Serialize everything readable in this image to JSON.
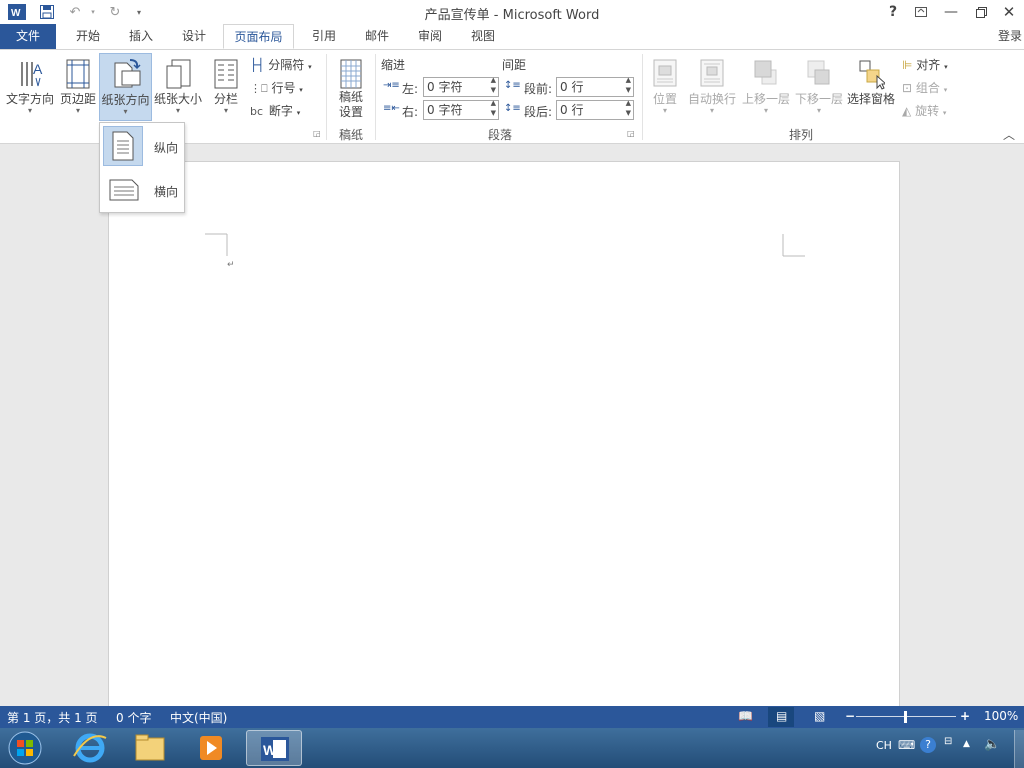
{
  "window": {
    "title": "产品宣传单 - Microsoft Word",
    "help": "?",
    "login": "登录"
  },
  "tabs": [
    {
      "label": "文件"
    },
    {
      "label": "开始"
    },
    {
      "label": "插入"
    },
    {
      "label": "设计"
    },
    {
      "label": "页面布局"
    },
    {
      "label": "引用"
    },
    {
      "label": "邮件"
    },
    {
      "label": "审阅"
    },
    {
      "label": "视图"
    }
  ],
  "ribbon": {
    "page_setup": {
      "text_direction": "文字方向",
      "margins": "页边距",
      "orientation": "纸张方向",
      "size": "纸张大小",
      "columns": "分栏",
      "breaks": "分隔符",
      "line_numbers": "行号",
      "hyphenation": "断字",
      "hyphen_icon": "bc"
    },
    "manuscript": {
      "button_line1": "稿纸",
      "button_line2": "设置",
      "group": "稿纸"
    },
    "paragraph": {
      "indent_label": "缩进",
      "spacing_label": "间距",
      "left_label": "左:",
      "right_label": "右:",
      "before_label": "段前:",
      "after_label": "段后:",
      "left_value": "0 字符",
      "right_value": "0 字符",
      "before_value": "0 行",
      "after_value": "0 行",
      "group": "段落"
    },
    "arrange": {
      "position": "位置",
      "wrap_text": "自动换行",
      "bring_forward": "上移一层",
      "send_backward": "下移一层",
      "selection_pane": "选择窗格",
      "align": "对齐",
      "group_btn": "组合",
      "rotate": "旋转",
      "group": "排列"
    }
  },
  "orientation_dropdown": {
    "portrait": "纵向",
    "landscape": "横向"
  },
  "status_bar": {
    "page": "第 1 页，共 1 页",
    "words": "0 个字",
    "language": "中文(中国)",
    "zoom": "100%"
  },
  "taskbar": {
    "lang": "CH"
  }
}
